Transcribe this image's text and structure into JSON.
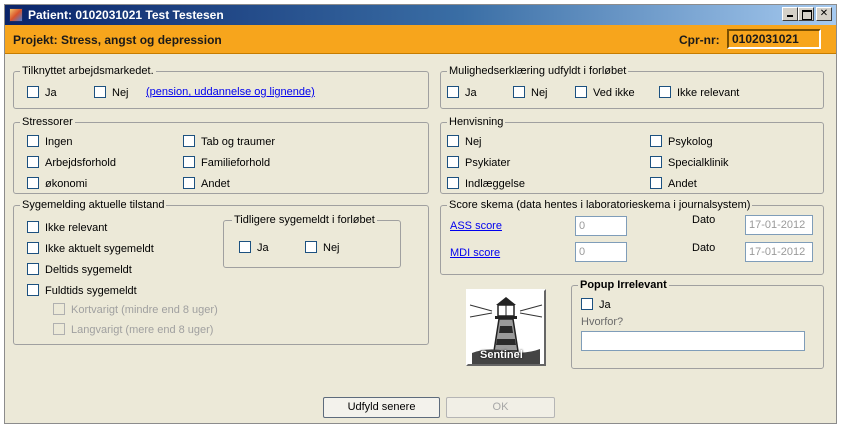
{
  "window": {
    "title": "Patient: 0102031021 Test Testesen"
  },
  "header": {
    "project": "Projekt:  Stress, angst og depression",
    "cpr_label": "Cpr-nr:",
    "cpr_value": "0102031021"
  },
  "arbejdsmarked": {
    "legend": "Tilknyttet arbejdsmarkedet.",
    "ja": "Ja",
    "nej": "Nej",
    "link": "(pension, uddannelse og lignende)"
  },
  "mulighed": {
    "legend": "Mulighedserklæring udfyldt i forløbet",
    "ja": "Ja",
    "nej": "Nej",
    "vedikke": "Ved ikke",
    "irrelevant": "Ikke relevant"
  },
  "stressorer": {
    "legend": "Stressorer",
    "items": [
      "Ingen",
      "Arbejdsforhold",
      "økonomi",
      "Tab og traumer",
      "Familieforhold",
      "Andet"
    ]
  },
  "henvisning": {
    "legend": "Henvisning",
    "items": [
      "Nej",
      "Psykiater",
      "Indlæggelse",
      "Psykolog",
      "Specialklinik",
      "Andet"
    ]
  },
  "sygemelding": {
    "legend": "Sygemelding aktuelle tilstand",
    "items": [
      "Ikke relevant",
      "Ikke aktuelt sygemeldt",
      "Deltids sygemeldt",
      "Fuldtids sygemeldt"
    ],
    "sub_items": [
      "Kortvarigt (mindre end 8 uger)",
      "Langvarigt (mere end 8 uger)"
    ],
    "tidligere": {
      "legend": "Tidligere sygemeldt i forløbet",
      "ja": "Ja",
      "nej": "Nej"
    }
  },
  "score": {
    "legend": "Score skema (data hentes i laboratorieskema i journalsystem)",
    "ass_label": "ASS score",
    "ass_value": "0",
    "mdi_label": "MDI score",
    "mdi_value": "0",
    "dato_label": "Dato",
    "ass_date": "17-01-2012",
    "mdi_date": "17-01-2012"
  },
  "popup": {
    "legend": "Popup Irrelevant",
    "ja": "Ja",
    "hvorfor": "Hvorfor?",
    "reason_value": ""
  },
  "logo": {
    "text": "Sentinel"
  },
  "buttons": {
    "later": "Udfyld senere",
    "ok": "OK"
  },
  "colors": {
    "titlebar": "#0a246a",
    "project_bar": "#f7a51c",
    "link": "#0000ee",
    "face": "#ece9d8"
  },
  "icons": [
    "app-icon",
    "minimize-icon",
    "maximize-icon",
    "close-icon",
    "lighthouse-icon"
  ]
}
